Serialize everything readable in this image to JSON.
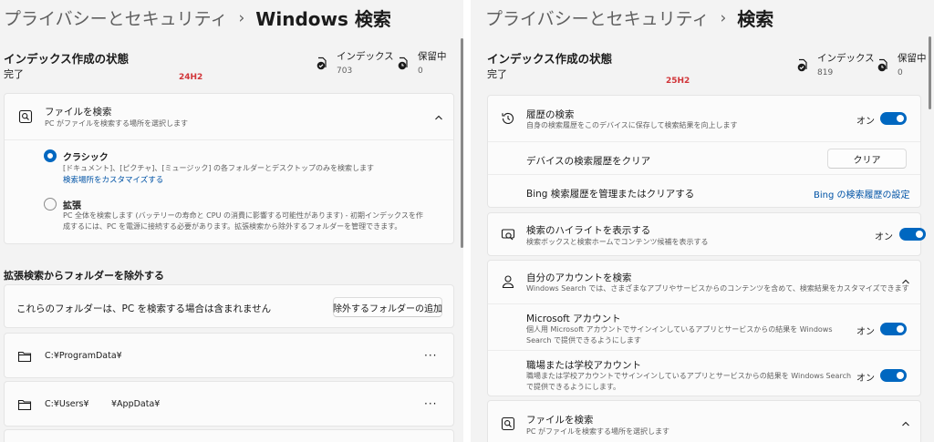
{
  "left": {
    "breadcrumb_parent": "プライバシーとセキュリティ",
    "breadcrumb_sep": "›",
    "breadcrumb_current": "Windows 検索",
    "status_title": "インデックス作成の状態",
    "status_value": "完了",
    "version_tag": "24H2",
    "stat_indexed_label": "インデックス",
    "stat_indexed_value": "703",
    "stat_pending_label": "保留中",
    "stat_pending_value": "0",
    "find_files_title": "ファイルを検索",
    "find_files_desc": "PC がファイルを検索する場所を選択します",
    "classic_title": "クラシック",
    "classic_desc": "[ドキュメント]、[ピクチャ]、[ミュージック] の各フォルダーとデスクトップのみを検索します",
    "classic_link": "検索場所をカスタマイズする",
    "enhanced_title": "拡張",
    "enhanced_desc": "PC 全体を検索します (バッテリーの寿命と CPU の消費に影響する可能性があります) - 初期インデックスを作成するには、PC を電源に接続する必要があります。拡張検索から除外するフォルダーを管理できます。",
    "exclude_heading": "拡張検索からフォルダーを除外する",
    "exclude_info": "これらのフォルダーは、PC を検索する場合は含まれません",
    "exclude_add_button": "除外するフォルダーの追加",
    "folder1_path": "C:¥ProgramData¥",
    "folder2_path_a": "C:¥Users¥",
    "folder2_path_b": "¥AppData¥",
    "more_label": "···"
  },
  "right": {
    "breadcrumb_parent": "プライバシーとセキュリティ",
    "breadcrumb_sep": "›",
    "breadcrumb_current": "検索",
    "status_title": "インデックス作成の状態",
    "status_value": "完了",
    "version_tag": "25H2",
    "stat_indexed_label": "インデックス",
    "stat_indexed_value": "819",
    "stat_pending_label": "保留中",
    "stat_pending_value": "0",
    "history_title": "履歴の検索",
    "history_desc": "自身の検索履歴をこのデバイスに保存して検索結果を向上します",
    "history_toggle": "オン",
    "clear_history_title": "デバイスの検索履歴をクリア",
    "clear_button": "クリア",
    "bing_history_title": "Bing 検索履歴を管理またはクリアする",
    "bing_history_link": "Bing の検索履歴の設定",
    "highlights_title": "検索のハイライトを表示する",
    "highlights_desc": "検索ボックスと検索ホームでコンテンツ候補を表示する",
    "highlights_toggle": "オン",
    "account_search_title": "自分のアカウントを検索",
    "account_search_desc": "Windows Search では、さまざまなアプリやサービスからのコンテンツを含めて、検索結果をカスタマイズできます",
    "msa_title": "Microsoft アカウント",
    "msa_desc": "個人用 Microsoft アカウントでサインインしているアプリとサービスからの結果を Windows Search で提供できるようにします",
    "msa_toggle": "オン",
    "work_title": "職場または学校アカウント",
    "work_desc": "職場または学校アカウントでサインインしているアプリとサービスからの結果を Windows Search で提供できるようにします。",
    "work_toggle": "オン",
    "find_files_title": "ファイルを検索",
    "find_files_desc": "PC がファイルを検索する場所を選択します"
  }
}
